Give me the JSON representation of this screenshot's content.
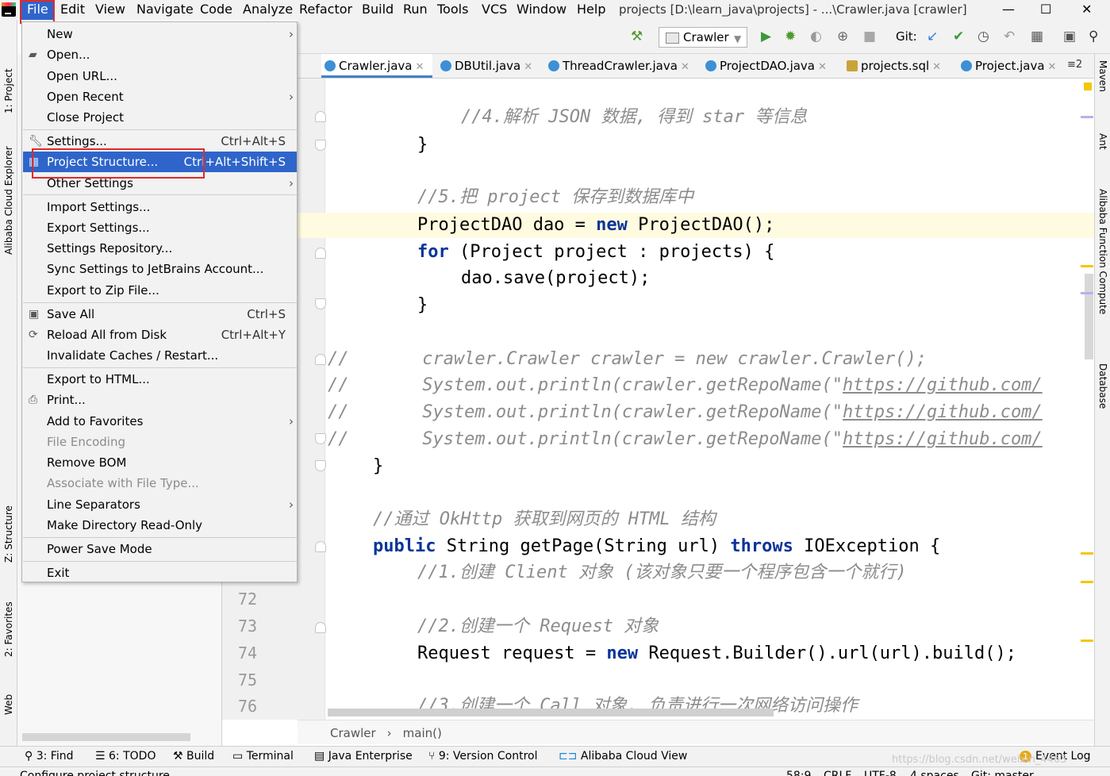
{
  "menubar": {
    "items": [
      "File",
      "Edit",
      "View",
      "Navigate",
      "Code",
      "Analyze",
      "Refactor",
      "Build",
      "Run",
      "Tools",
      "VCS",
      "Window",
      "Help"
    ],
    "window_title": "projects [D:\\learn_java\\projects] - ...\\Crawler.java [crawler]"
  },
  "file_menu": {
    "items": [
      {
        "label": "New",
        "shortcut": "",
        "submenu": true
      },
      {
        "label": "Open...",
        "shortcut": "",
        "icon": "folder-icon"
      },
      {
        "label": "Open URL...",
        "shortcut": ""
      },
      {
        "label": "Open Recent",
        "shortcut": "",
        "submenu": true
      },
      {
        "label": "Close Project",
        "shortcut": ""
      },
      {
        "label": "Settings...",
        "shortcut": "Ctrl+Alt+S",
        "icon": "wrench-icon"
      },
      {
        "label": "Project Structure...",
        "shortcut": "Ctrl+Alt+Shift+S",
        "icon": "project-structure-icon",
        "selected": true
      },
      {
        "label": "Other Settings",
        "shortcut": "",
        "submenu": true
      },
      {
        "label": "Import Settings...",
        "shortcut": ""
      },
      {
        "label": "Export Settings...",
        "shortcut": ""
      },
      {
        "label": "Settings Repository...",
        "shortcut": ""
      },
      {
        "label": "Sync Settings to JetBrains Account...",
        "shortcut": ""
      },
      {
        "label": "Export to Zip File...",
        "shortcut": ""
      },
      {
        "label": "Save All",
        "shortcut": "Ctrl+S",
        "icon": "save-icon"
      },
      {
        "label": "Reload All from Disk",
        "shortcut": "Ctrl+Alt+Y",
        "icon": "reload-icon"
      },
      {
        "label": "Invalidate Caches / Restart...",
        "shortcut": ""
      },
      {
        "label": "Export to HTML...",
        "shortcut": ""
      },
      {
        "label": "Print...",
        "shortcut": "",
        "icon": "print-icon"
      },
      {
        "label": "Add to Favorites",
        "shortcut": "",
        "submenu": true
      },
      {
        "label": "File Encoding",
        "shortcut": "",
        "disabled": true
      },
      {
        "label": "Remove BOM",
        "shortcut": ""
      },
      {
        "label": "Associate with File Type...",
        "shortcut": "",
        "disabled": true
      },
      {
        "label": "Line Separators",
        "shortcut": "",
        "submenu": true
      },
      {
        "label": "Make Directory Read-Only",
        "shortcut": ""
      },
      {
        "label": "Power Save Mode",
        "shortcut": ""
      },
      {
        "label": "Exit",
        "shortcut": ""
      }
    ]
  },
  "toolbar": {
    "run_config": "Crawler",
    "git_label": "Git:"
  },
  "tabs": [
    {
      "label": "Crawler.java",
      "active": true
    },
    {
      "label": "DBUtil.java"
    },
    {
      "label": "ThreadCrawler.java"
    },
    {
      "label": "ProjectDAO.java"
    },
    {
      "label": "projects.sql",
      "type": "sql"
    },
    {
      "label": "Project.java"
    }
  ],
  "tab_more": "≡2",
  "left_tools": [
    "1: Project",
    "Alibaba Cloud Explorer",
    "Z: Structure",
    "2: Favorites",
    "Web"
  ],
  "right_tools": [
    "Maven",
    "Ant",
    "Alibaba Function Compute",
    "Database"
  ],
  "code": {
    "line1": "//4.解析 JSON 数据, 得到 star 等信息",
    "line2": "}",
    "line3": "//5.把 project 保存到数据库中",
    "line4": "ProjectDAO dao = new ProjectDAO();",
    "line5": "for (Project project : projects) {",
    "line6": "dao.save(project);",
    "line7": "}",
    "line8": "//       crawler.Crawler crawler = new crawler.Crawler();",
    "line9": "//       System.out.println(crawler.getRepoName(\"https://github.com/",
    "line10": "//       System.out.println(crawler.getRepoName(\"https://github.com/",
    "line11": "//       System.out.println(crawler.getRepoName(\"https://github.com/",
    "line12": "}",
    "line13": "//通过 OkHttp 获取到网页的 HTML 结构",
    "line14": "public String getPage(String url) throws IOException {",
    "line15": "//1.创建 Client 对象 (该对象只要一个程序包含一个就行)",
    "line16": "//2.创建一个 Request 对象",
    "line17": "Request request = new Request.Builder().url(url).build();",
    "line18": "//3.创建一个 Call 对象, 负责进行一次网络访问操作"
  },
  "line_numbers": [
    "72",
    "73",
    "74",
    "75",
    "76"
  ],
  "breadcrumb": [
    "Crawler",
    "main()"
  ],
  "bottom_tools": [
    "3: Find",
    "6: TODO",
    "Build",
    "Terminal",
    "Java Enterprise",
    "9: Version Control",
    "Alibaba Cloud View"
  ],
  "event_log": {
    "label": "Event Log",
    "count": "1"
  },
  "watermark": "https://blog.csdn.net/weixin_4463",
  "status": {
    "message": "Configure project structure",
    "position": "58:9",
    "line_sep": "CRLF",
    "encoding": "UTF-8",
    "indent": "4 spaces",
    "branch": "Git: master"
  },
  "colors": {
    "selection": "#2f65ca",
    "highlight_box": "#e02a2a",
    "keyword": "#0a3499",
    "comment": "#8c8c8c"
  }
}
